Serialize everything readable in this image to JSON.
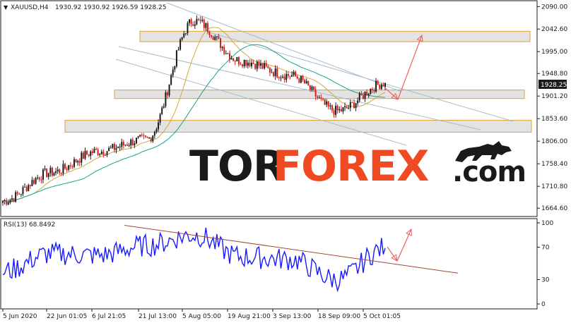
{
  "header": {
    "symbol": "XAUUSD,H4",
    "ohlc": "1930.92 1930.92 1926.59 1928.25",
    "down_arrow": "▼"
  },
  "price_axis": {
    "ticks": [
      "2090.00",
      "2042.60",
      "1995.00",
      "1948.80",
      "1901.20",
      "1853.60",
      "1806.00",
      "1758.40",
      "1710.80",
      "1664.60"
    ],
    "current_price": "1928.25"
  },
  "rsi_panel": {
    "label": "RSI(13) 68.8492",
    "ticks": [
      "100",
      "70",
      "30",
      "0"
    ]
  },
  "time_axis": {
    "labels": [
      "5 Jun 2020",
      "22 Jun 01:05",
      "6 Jul 21:05",
      "21 Jul 13:00",
      "5 Aug 05:00",
      "19 Aug 21:00",
      "3 Sep 13:00",
      "18 Sep 09:00",
      "5 Oct 01:05"
    ]
  },
  "logo": {
    "part1": "TOR",
    "part2": "FOREX",
    "part3": ".com"
  },
  "colors": {
    "candle_up": "#1a1a1a",
    "candle_down": "#d0201a",
    "ma_fast": "#d4a93a",
    "ma_slow": "#1aa08a",
    "rsi_line": "#1a1aff",
    "zone_fill": "#d9d9d9",
    "zone_border": "#e0a030",
    "channel_line": "#a8bccb",
    "rsi_trend": "#a04a3a",
    "forecast_arrow": "#f06060",
    "logo_orange": "#f04a23"
  },
  "chart_data": [
    {
      "type": "candlestick",
      "title": "XAUUSD,H4",
      "ylim": [
        1650,
        2095
      ],
      "x": [
        "5 Jun 2020",
        "22 Jun 01:05",
        "6 Jul 21:05",
        "21 Jul 13:00",
        "5 Aug 05:00",
        "19 Aug 21:00",
        "3 Sep 13:00",
        "18 Sep 09:00",
        "5 Oct 01:05"
      ],
      "close": [
        1680,
        1740,
        1785,
        1810,
        2060,
        1975,
        1945,
        1870,
        1928.25
      ],
      "last": 1928.25,
      "resistance_zones": [
        [
          2016,
          2038
        ],
        [
          1896,
          1914
        ],
        [
          1825,
          1850
        ]
      ]
    },
    {
      "type": "line",
      "title": "RSI(13) 68.8492",
      "ylim": [
        0,
        100
      ],
      "x": [
        "5 Jun 2020",
        "22 Jun 01:05",
        "6 Jul 21:05",
        "21 Jul 13:00",
        "5 Aug 05:00",
        "19 Aug 21:00",
        "3 Sep 13:00",
        "18 Sep 09:00",
        "5 Oct 01:05"
      ],
      "values": [
        40,
        62,
        60,
        72,
        85,
        58,
        55,
        30,
        68.85
      ],
      "last": 68.8492
    }
  ]
}
